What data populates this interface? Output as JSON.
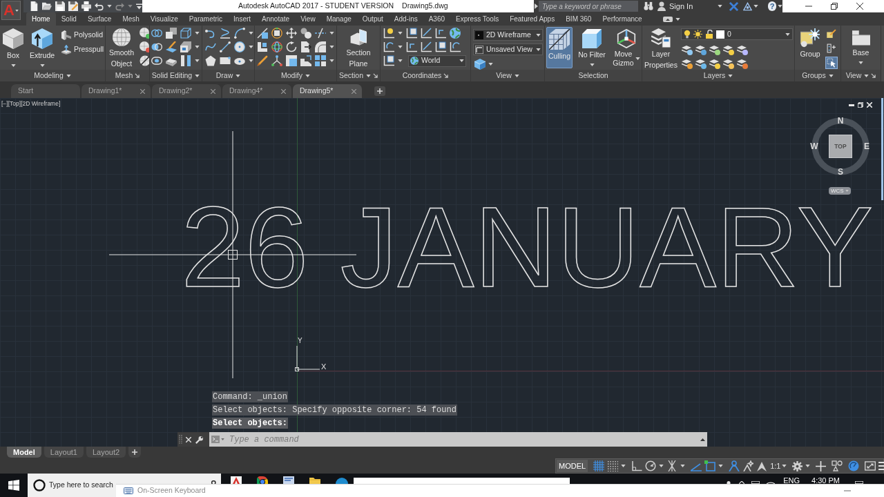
{
  "app_button": {
    "logo": "A"
  },
  "title_bar": {
    "title": "Autodesk AutoCAD 2017 - STUDENT VERSION",
    "file_name": "Drawing5.dwg",
    "search": {
      "placeholder": "Type a keyword or phrase"
    },
    "sign_in": "Sign In",
    "help": "?"
  },
  "ribbon_tabs": [
    {
      "label": "Home",
      "selected": true
    },
    {
      "label": "Solid",
      "selected": false
    },
    {
      "label": "Surface",
      "selected": false
    },
    {
      "label": "Mesh",
      "selected": false
    },
    {
      "label": "Visualize",
      "selected": false
    },
    {
      "label": "Parametric",
      "selected": false
    },
    {
      "label": "Insert",
      "selected": false
    },
    {
      "label": "Annotate",
      "selected": false
    },
    {
      "label": "View",
      "selected": false
    },
    {
      "label": "Manage",
      "selected": false
    },
    {
      "label": "Output",
      "selected": false
    },
    {
      "label": "Add-ins",
      "selected": false
    },
    {
      "label": "A360",
      "selected": false
    },
    {
      "label": "Express Tools",
      "selected": false
    },
    {
      "label": "Featured Apps",
      "selected": false
    },
    {
      "label": "BIM 360",
      "selected": false
    },
    {
      "label": "Performance",
      "selected": false
    }
  ],
  "ribbon_panels": [
    {
      "title": "Modeling",
      "menu": true,
      "launcher": false,
      "large_buttons": [
        {
          "label": "Box",
          "caret": true
        },
        {
          "label": "Extrude",
          "caret": true
        }
      ],
      "small_buttons": [
        {
          "label": "Polysolid"
        },
        {
          "label": "Presspull"
        }
      ]
    },
    {
      "title": "Mesh",
      "menu": false,
      "launcher": true,
      "large_buttons": [
        {
          "label": "Smooth\nObject",
          "caret": false
        }
      ]
    },
    {
      "title": "Solid Editing",
      "menu": true,
      "launcher": false
    },
    {
      "title": "Draw",
      "menu": true,
      "launcher": false
    },
    {
      "title": "Modify",
      "menu": true,
      "launcher": false
    },
    {
      "title": "Section",
      "menu": true,
      "launcher": true,
      "large_buttons": [
        {
          "label": "Section\nPlane",
          "caret": false
        }
      ]
    },
    {
      "title": "Coordinates",
      "menu": false,
      "launcher": true,
      "dropdowns": [
        {
          "value": "World"
        }
      ]
    },
    {
      "title": "View",
      "menu": true,
      "launcher": false,
      "dropdowns": [
        {
          "value": "2D Wireframe"
        },
        {
          "value": "Unsaved View"
        }
      ]
    },
    {
      "title": "Selection",
      "menu": false,
      "launcher": false,
      "large_buttons": [
        {
          "label": "Culling",
          "caret": false,
          "on": true
        },
        {
          "label": "No Filter",
          "caret": true,
          "on": false
        },
        {
          "label": "Move\nGizmo",
          "caret": true,
          "on": false
        }
      ]
    },
    {
      "title": "Layers",
      "menu": true,
      "launcher": false,
      "large_buttons": [
        {
          "label": "Layer\nProperties",
          "caret": false
        }
      ],
      "dropdowns": [
        {
          "value": "0"
        }
      ]
    },
    {
      "title": "Groups",
      "menu": true,
      "launcher": false,
      "large_buttons": [
        {
          "label": "Group",
          "caret": false
        }
      ],
      "toggles": [
        {
          "on": false
        },
        {
          "on": false
        },
        {
          "on": true
        }
      ]
    },
    {
      "title": "View",
      "menu": true,
      "launcher": true,
      "large_buttons": [
        {
          "label": "Base",
          "caret": true
        }
      ]
    }
  ],
  "document_tabs": [
    {
      "label": "Start",
      "selected": false,
      "closable": false
    },
    {
      "label": "Drawing1*",
      "selected": false,
      "closable": true
    },
    {
      "label": "Drawing2*",
      "selected": false,
      "closable": true
    },
    {
      "label": "Drawing4*",
      "selected": false,
      "closable": true
    },
    {
      "label": "Drawing5*",
      "selected": true,
      "closable": true
    }
  ],
  "viewport": {
    "controls": [
      "[−]",
      "[Top]",
      "[2D Wireframe]"
    ],
    "drawing_text": "26 JANUARY",
    "ucs": {
      "x_label": "X",
      "y_label": "Y"
    },
    "view_cube": {
      "face": "TOP",
      "north": "N",
      "east": "E",
      "south": "S",
      "west": "W",
      "coordinate_system": "WCS"
    }
  },
  "command_line": {
    "history": [
      "Command: _union",
      "Select objects: Specify opposite corner: 54 found",
      "Select objects:"
    ],
    "input": {
      "placeholder": "Type a command"
    }
  },
  "layout_tabs": [
    {
      "label": "Model",
      "selected": true
    },
    {
      "label": "Layout1",
      "selected": false
    },
    {
      "label": "Layout2",
      "selected": false
    }
  ],
  "status_bar": {
    "space": "MODEL",
    "toggles": [
      {
        "on": true
      },
      {
        "on": false
      },
      {
        "on": false
      },
      {
        "on": false
      },
      {
        "on": false
      },
      {
        "on": true
      },
      {
        "on": true
      },
      {
        "on": true
      },
      {
        "on": false
      },
      {
        "on": false
      }
    ],
    "scale": "1:1",
    "right_toggles": [
      {
        "on": false
      },
      {
        "on": true
      }
    ]
  },
  "taskbar": {
    "search": {
      "placeholder": "Type here to search"
    },
    "language": "ENG",
    "time": "4:30 PM"
  },
  "on_screen_keyboard": {
    "title": "On-Screen Keyboard"
  }
}
